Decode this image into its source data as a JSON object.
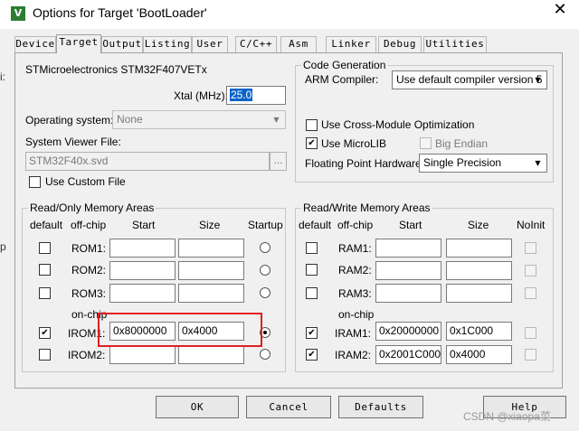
{
  "window": {
    "title": "Options for Target 'BootLoader'",
    "close_glyph": "✕",
    "app_icon_glyph": "V"
  },
  "tabs": [
    {
      "label": "Device"
    },
    {
      "label": "Target"
    },
    {
      "label": "Output"
    },
    {
      "label": "Listing"
    },
    {
      "label": "User"
    },
    {
      "label": "C/C++"
    },
    {
      "label": "Asm"
    },
    {
      "label": "Linker"
    },
    {
      "label": "Debug"
    },
    {
      "label": "Utilities"
    }
  ],
  "active_tab": "Target",
  "device": {
    "name": "STMicroelectronics STM32F407VETx"
  },
  "xtal": {
    "label": "Xtal (MHz):",
    "value": "25.0"
  },
  "os": {
    "label": "Operating system:",
    "value": "None"
  },
  "svd": {
    "label": "System Viewer File:",
    "value": "STM32F40x.svd",
    "browse": "..."
  },
  "use_custom_file": {
    "label": "Use Custom File",
    "checked": false
  },
  "code_gen": {
    "title": "Code Generation",
    "arm_compiler_label": "ARM Compiler:",
    "arm_compiler_value": "Use default compiler version 5",
    "cross_module": {
      "label": "Use Cross-Module Optimization",
      "checked": false
    },
    "microlib": {
      "label": "Use MicroLIB",
      "checked": true
    },
    "big_endian": {
      "label": "Big Endian",
      "checked": false,
      "disabled": true
    },
    "fp_label": "Floating Point Hardware:",
    "fp_value": "Single Precision"
  },
  "ro_memory": {
    "title": "Read/Only Memory Areas",
    "headers": {
      "default": "default",
      "offchip": "off-chip",
      "start": "Start",
      "size": "Size",
      "startup": "Startup"
    },
    "onchip_label": "on-chip",
    "rows": [
      {
        "name": "ROM1:",
        "start": "",
        "size": "",
        "default": false,
        "startup": false
      },
      {
        "name": "ROM2:",
        "start": "",
        "size": "",
        "default": false,
        "startup": false
      },
      {
        "name": "ROM3:",
        "start": "",
        "size": "",
        "default": false,
        "startup": false
      },
      {
        "name": "IROM1:",
        "start": "0x8000000",
        "size": "0x4000",
        "default": true,
        "startup": true
      },
      {
        "name": "IROM2:",
        "start": "",
        "size": "",
        "default": false,
        "startup": false
      }
    ]
  },
  "rw_memory": {
    "title": "Read/Write Memory Areas",
    "headers": {
      "default": "default",
      "offchip": "off-chip",
      "start": "Start",
      "size": "Size",
      "noinit": "NoInit"
    },
    "onchip_label": "on-chip",
    "rows": [
      {
        "name": "RAM1:",
        "start": "",
        "size": "",
        "default": false,
        "noinit": false
      },
      {
        "name": "RAM2:",
        "start": "",
        "size": "",
        "default": false,
        "noinit": false
      },
      {
        "name": "RAM3:",
        "start": "",
        "size": "",
        "default": false,
        "noinit": false
      },
      {
        "name": "IRAM1:",
        "start": "0x20000000",
        "size": "0x1C000",
        "default": true,
        "noinit": false
      },
      {
        "name": "IRAM2:",
        "start": "0x2001C000",
        "size": "0x4000",
        "default": true,
        "noinit": false
      }
    ]
  },
  "buttons": {
    "ok": "OK",
    "cancel": "Cancel",
    "defaults": "Defaults",
    "help": "Help"
  },
  "watermark": "CSDN @xiaopa菜",
  "edge_fragments": {
    "upper": "i:",
    "lower": "p"
  },
  "check_glyph": "✔",
  "arrow_glyph": "▼"
}
